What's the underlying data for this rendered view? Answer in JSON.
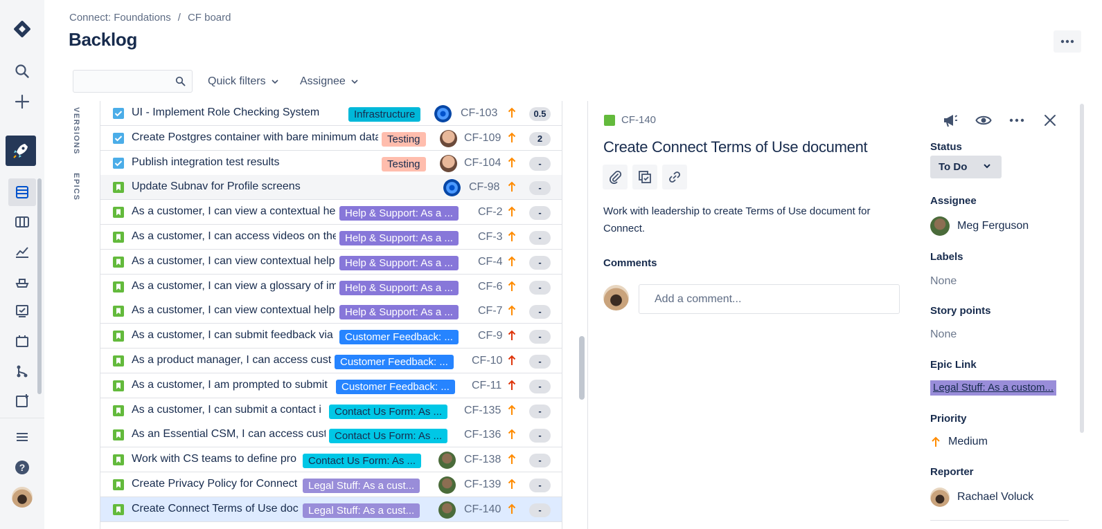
{
  "breadcrumb": {
    "project": "Connect: Foundations",
    "separator": "/",
    "board": "CF board"
  },
  "page": {
    "title": "Backlog"
  },
  "toolbar": {
    "search_placeholder": "",
    "quick_filters": "Quick filters",
    "assignee": "Assignee"
  },
  "side_tabs": {
    "versions": "VERSIONS",
    "epics": "EPICS"
  },
  "issues": [
    {
      "type": "task",
      "title": "UI - Implement Role Checking System",
      "epic": "Infrastructure",
      "epic_style": "infra",
      "assignee": "swirl",
      "key": "CF-103",
      "priority": "high",
      "points": "0.5"
    },
    {
      "type": "task",
      "title": "Create Postgres container with bare minimum data",
      "epic": "Testing",
      "epic_style": "testing",
      "assignee": "bald",
      "key": "CF-109",
      "priority": "high",
      "points": "2"
    },
    {
      "type": "task",
      "title": "Publish integration test results",
      "epic": "Testing",
      "epic_style": "testing",
      "assignee": "bald",
      "key": "CF-104",
      "priority": "high",
      "points": "-"
    },
    {
      "type": "story",
      "title": "Update Subnav for Profile screens",
      "epic": "",
      "epic_style": "",
      "assignee": "swirl",
      "key": "CF-98",
      "priority": "high",
      "points": "-"
    },
    {
      "type": "story",
      "title": "As a customer, I can view a contextual help",
      "epic": "Help & Support: As a ...",
      "epic_style": "help",
      "assignee": "",
      "key": "CF-2",
      "priority": "high",
      "points": "-"
    },
    {
      "type": "story",
      "title": "As a customer, I can access videos on the",
      "epic": "Help & Support: As a ...",
      "epic_style": "help",
      "assignee": "",
      "key": "CF-3",
      "priority": "high",
      "points": "-"
    },
    {
      "type": "story",
      "title": "As a customer, I can view contextual help",
      "epic": "Help & Support: As a ...",
      "epic_style": "help",
      "assignee": "",
      "key": "CF-4",
      "priority": "high",
      "points": "-"
    },
    {
      "type": "story",
      "title": "As a customer, I can view a glossary of im",
      "epic": "Help & Support: As a ...",
      "epic_style": "help",
      "assignee": "",
      "key": "CF-6",
      "priority": "high",
      "points": "-"
    },
    {
      "type": "story",
      "title": "As a customer, I can view contextual help",
      "epic": "Help & Support: As a ...",
      "epic_style": "help",
      "assignee": "",
      "key": "CF-7",
      "priority": "high",
      "points": "-"
    },
    {
      "type": "story",
      "title": "As a customer, I can submit feedback via",
      "epic": "Customer Feedback: ...",
      "epic_style": "feedback",
      "assignee": "",
      "key": "CF-9",
      "priority": "highest",
      "points": "-"
    },
    {
      "type": "story",
      "title": "As a product manager, I can access cust",
      "epic": "Customer Feedback: ...",
      "epic_style": "feedback",
      "assignee": "",
      "key": "CF-10",
      "priority": "highest",
      "points": "-"
    },
    {
      "type": "story",
      "title": "As a customer, I am prompted to submit",
      "epic": "Customer Feedback: ...",
      "epic_style": "feedback",
      "assignee": "",
      "key": "CF-11",
      "priority": "highest",
      "points": "-"
    },
    {
      "type": "story",
      "title": "As a customer, I can submit a contact i",
      "epic": "Contact Us Form: As ...",
      "epic_style": "contact",
      "assignee": "",
      "key": "CF-135",
      "priority": "high",
      "points": "-"
    },
    {
      "type": "story",
      "title": "As an Essential CSM, I can access cust",
      "epic": "Contact Us Form: As ...",
      "epic_style": "contact",
      "assignee": "",
      "key": "CF-136",
      "priority": "high",
      "points": "-"
    },
    {
      "type": "story",
      "title": "Work with CS teams to define pro",
      "epic": "Contact Us Form: As ...",
      "epic_style": "contact",
      "assignee": "green",
      "key": "CF-138",
      "priority": "high",
      "points": "-"
    },
    {
      "type": "story",
      "title": "Create Privacy Policy for Connect",
      "epic": "Legal Stuff: As a cust...",
      "epic_style": "legal",
      "assignee": "green",
      "key": "CF-139",
      "priority": "high",
      "points": "-"
    },
    {
      "type": "story",
      "title": "Create Connect Terms of Use doc",
      "epic": "Legal Stuff: As a cust...",
      "epic_style": "legal",
      "assignee": "green",
      "key": "CF-140",
      "priority": "high",
      "points": "-"
    }
  ],
  "detail": {
    "key": "CF-140",
    "title": "Create Connect Terms of Use document",
    "description": "Work with leadership to create Terms of Use document for Connect.",
    "comments_label": "Comments",
    "comment_placeholder": "Add a comment...",
    "status_label": "Status",
    "status_value": "To Do",
    "assignee_label": "Assignee",
    "assignee_value": "Meg Ferguson",
    "labels_label": "Labels",
    "labels_value": "None",
    "story_points_label": "Story points",
    "story_points_value": "None",
    "epic_link_label": "Epic Link",
    "epic_link_value": "Legal Stuff: As a custom...",
    "priority_label": "Priority",
    "priority_value": "Medium",
    "reporter_label": "Reporter",
    "reporter_value": "Rachael Voluck"
  },
  "colors": {
    "accent": "#0052cc",
    "priority_high": "#ff8b00",
    "priority_highest": "#de350b"
  }
}
